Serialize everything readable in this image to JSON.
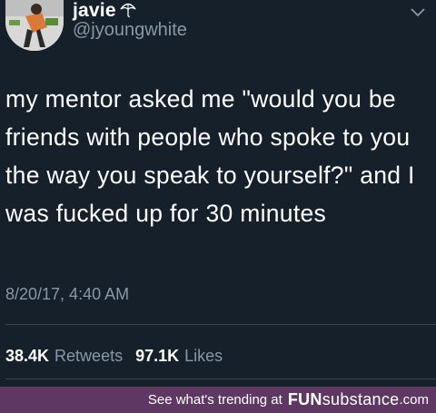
{
  "profile": {
    "display_name": "javie",
    "handle": "@jyoungwhite",
    "badge_icon": "umbrella-icon",
    "menu_icon": "chevron-down-icon"
  },
  "tweet": {
    "text": "my mentor asked me \"would you be friends with people who spoke to you the way you speak to yourself?\" and I was fucked up for 30 minutes",
    "timestamp": "8/20/17, 4:40 AM"
  },
  "stats": {
    "retweets_count": "38.4K",
    "retweets_label": "Retweets",
    "likes_count": "97.1K",
    "likes_label": "Likes"
  },
  "footer": {
    "prefix": "See what's trending at",
    "brand_bold": "FUN",
    "brand_light": "substance",
    "domain": ".com"
  },
  "colors": {
    "background": "#15202b",
    "secondary_text": "#8899a6",
    "footer_bg": "#5e3862"
  }
}
